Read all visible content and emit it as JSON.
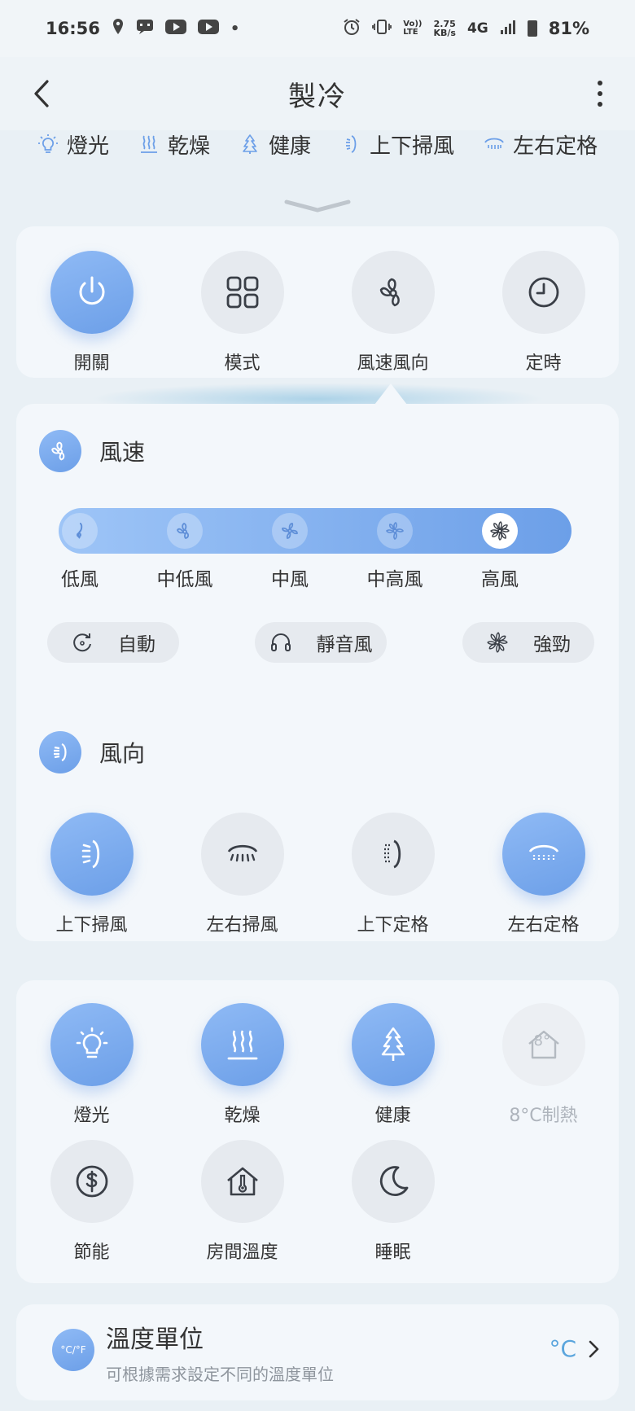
{
  "status_bar": {
    "time": "16:56",
    "dot": "•",
    "speed_value": "2.75",
    "speed_unit": "KB/s",
    "network": "4G",
    "volte_top": "Vo))",
    "volte_bottom": "LTE",
    "battery": "81%"
  },
  "header": {
    "title": "製冷"
  },
  "active_tags": [
    {
      "label": "燈光",
      "icon": "bulb-icon"
    },
    {
      "label": "乾燥",
      "icon": "dry-icon"
    },
    {
      "label": "健康",
      "icon": "tree-icon"
    },
    {
      "label": "上下掃風",
      "icon": "vertical-swing-icon"
    },
    {
      "label": "左右定格",
      "icon": "horizontal-fixed-icon"
    }
  ],
  "quick_controls": [
    {
      "label": "開關",
      "icon": "power-icon",
      "active": true
    },
    {
      "label": "模式",
      "icon": "grid-icon",
      "active": false
    },
    {
      "label": "風速風向",
      "icon": "fan-icon",
      "active": false
    },
    {
      "label": "定時",
      "icon": "clock-icon",
      "active": false
    }
  ],
  "fan_speed": {
    "title": "風速",
    "levels": [
      "低風",
      "中低風",
      "中風",
      "中高風",
      "高風"
    ],
    "selected": "高風",
    "options": [
      "自動",
      "靜音風",
      "強勁"
    ]
  },
  "wind_direction": {
    "title": "風向",
    "options": [
      {
        "label": "上下掃風",
        "active": true
      },
      {
        "label": "左右掃風",
        "active": false
      },
      {
        "label": "上下定格",
        "active": false
      },
      {
        "label": "左右定格",
        "active": true
      }
    ]
  },
  "functions": [
    {
      "label": "燈光",
      "icon": "bulb-icon",
      "state": "active"
    },
    {
      "label": "乾燥",
      "icon": "dry-icon",
      "state": "active"
    },
    {
      "label": "健康",
      "icon": "tree-icon",
      "state": "active"
    },
    {
      "label": "8°C制熱",
      "icon": "house-8-icon",
      "state": "disabled",
      "badge": "8°"
    },
    {
      "label": "節能",
      "icon": "dollar-icon",
      "state": "inactive"
    },
    {
      "label": "房間溫度",
      "icon": "house-thermometer-icon",
      "state": "inactive"
    },
    {
      "label": "睡眠",
      "icon": "moon-icon",
      "state": "inactive"
    }
  ],
  "temperature_unit": {
    "title": "溫度單位",
    "description": "可根據需求設定不同的溫度單位",
    "value": "°C",
    "icon_text": "°C/°F"
  },
  "colors": {
    "accent": "#6c9fe8",
    "accent_light": "#8fbaf5",
    "unit_value": "#5aa5dd"
  }
}
